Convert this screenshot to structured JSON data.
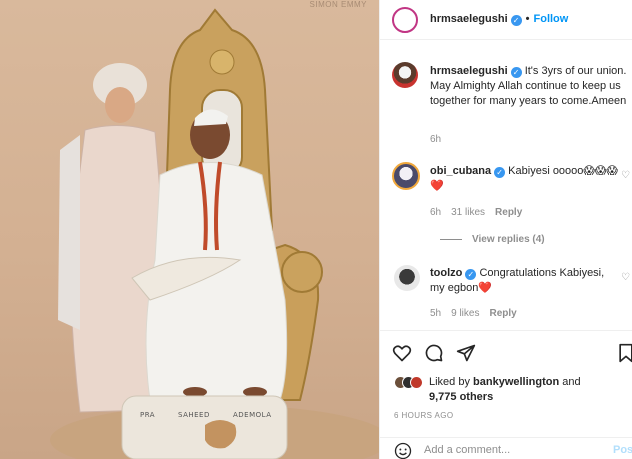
{
  "photo": {
    "watermark": "SIMON EMMY",
    "pillow_left": "PRA",
    "pillow_mid": "SAHEED",
    "pillow_right": "ADEMOLA"
  },
  "header": {
    "username": "hrmsaelegushi",
    "dot": "•",
    "follow_label": "Follow"
  },
  "caption": {
    "username": "hrmsaelegushi",
    "text": " It's 3yrs of our union. May Almighty Allah continue to keep us together for many years to come.Ameen",
    "time": "6h"
  },
  "comments": [
    {
      "username": "obi_cubana",
      "text": " Kabiyesi ooooo😱😱😱❤️",
      "time": "6h",
      "likes": "31 likes",
      "reply_label": "Reply",
      "view_replies": "View replies (4)"
    },
    {
      "username": "toolzo",
      "text": " Congratulations Kabiyesi, my egbon❤️",
      "time": "5h",
      "likes": "9 likes",
      "reply_label": "Reply"
    }
  ],
  "likes": {
    "prefix": "Liked by ",
    "user": "bankywellington",
    "middle": " and",
    "count": "9,775 others"
  },
  "timestamp": "6 HOURS AGO",
  "add_comment": {
    "placeholder": "Add a comment...",
    "post_label": "Post"
  },
  "colors": {
    "link_blue": "#0095f6",
    "verified_blue": "#3897f0",
    "muted": "#8e8e8e",
    "text": "#262626",
    "border": "#efefef"
  },
  "icons": [
    "heart-icon",
    "comment-icon",
    "share-icon",
    "bookmark-icon",
    "emoji-icon",
    "verified-icon"
  ]
}
